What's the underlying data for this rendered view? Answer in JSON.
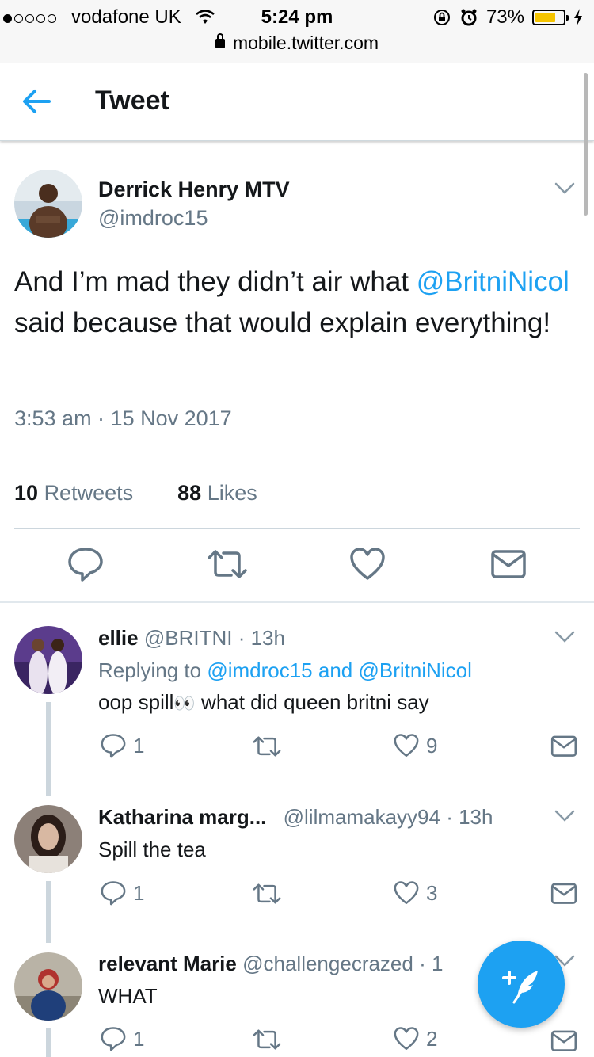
{
  "status_bar": {
    "carrier": "vodafone UK",
    "time": "5:24 pm",
    "battery": "73%",
    "battery_level": 0.73,
    "url": "mobile.twitter.com"
  },
  "header": {
    "title": "Tweet"
  },
  "tweet": {
    "name": "Derrick Henry MTV",
    "handle": "@imdroc15",
    "text_before": "And I’m mad they didn’t air what ",
    "mention": "@BritniNicol",
    "text_after": " said because that would explain everything!",
    "date": "3:53 am · 15 Nov 2017",
    "retweets_count": "10",
    "retweets_label": "Retweets",
    "likes_count": "88",
    "likes_label": "Likes"
  },
  "replies": [
    {
      "name": "ellie",
      "handle": "@BRITNI",
      "time": "· 13h",
      "replying_prefix": "Replying to ",
      "replying_to": "@imdroc15 and @BritniNicol",
      "text_a": "oop spill",
      "emoji": "👀",
      "text_b": " what did queen britni say",
      "replies": "1",
      "likes": "9"
    },
    {
      "name": "Katharina marg...",
      "handle": "@lilmamakayy94",
      "time": "· 13h",
      "text": "Spill the tea",
      "replies": "1",
      "likes": "3"
    },
    {
      "name": "relevant Marie",
      "handle": "@challengecrazed",
      "time": "· 1",
      "text": "WHAT",
      "replies": "1",
      "likes": "2"
    }
  ],
  "colors": {
    "accent": "#1da1f2",
    "muted": "#657786",
    "text": "#14171a"
  },
  "icons": [
    "back-arrow-icon",
    "chevron-down-icon",
    "reply-icon",
    "retweet-icon",
    "like-icon",
    "dm-icon",
    "compose-tweet-icon"
  ]
}
